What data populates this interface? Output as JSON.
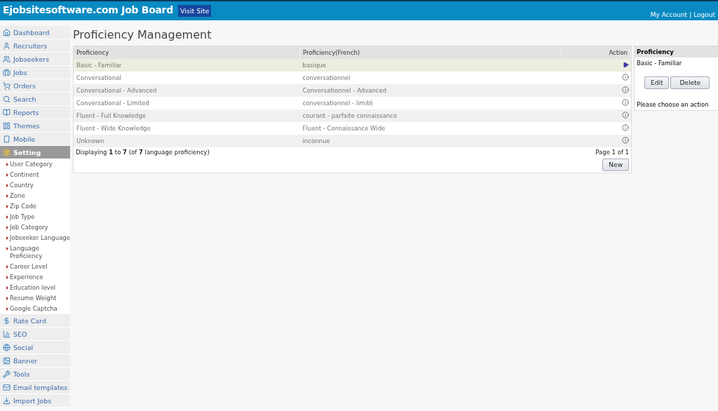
{
  "header": {
    "title": "Ejobsitesoftware.com Job Board",
    "visit_site": "Visit Site",
    "links": [
      "My Account",
      "Logout"
    ],
    "separator": "|"
  },
  "sidebar": {
    "items": [
      {
        "label": "Dashboard",
        "selected": false
      },
      {
        "label": "Recruiters",
        "selected": false
      },
      {
        "label": "Jobseekers",
        "selected": false
      },
      {
        "label": "Jobs",
        "selected": false
      },
      {
        "label": "Orders",
        "selected": false
      },
      {
        "label": "Search",
        "selected": false
      },
      {
        "label": "Reports",
        "selected": false
      },
      {
        "label": "Themes",
        "selected": false
      },
      {
        "label": "Mobile",
        "selected": false
      },
      {
        "label": "Setting",
        "selected": true,
        "children": [
          {
            "label": "User Category"
          },
          {
            "label": "Continent"
          },
          {
            "label": "Country"
          },
          {
            "label": "Zone"
          },
          {
            "label": "Zip Code"
          },
          {
            "label": "Job Type"
          },
          {
            "label": "Job Category"
          },
          {
            "label": "Jobseeker Language"
          },
          {
            "label": "Language Proficiency"
          },
          {
            "label": "Career Level"
          },
          {
            "label": "Experience"
          },
          {
            "label": "Education level"
          },
          {
            "label": "Resume Weight"
          },
          {
            "label": "Google Captcha"
          }
        ]
      },
      {
        "label": "Rate Card",
        "selected": false
      },
      {
        "label": "SEO",
        "selected": false
      },
      {
        "label": "Social",
        "selected": false
      },
      {
        "label": "Banner",
        "selected": false
      },
      {
        "label": "Tools",
        "selected": false
      },
      {
        "label": "Email templates",
        "selected": false
      },
      {
        "label": "Import Jobs",
        "selected": false
      }
    ]
  },
  "page_title": "Proficiency Management",
  "table": {
    "columns": [
      "Proficiency",
      "Proficiency(French)",
      "Action"
    ],
    "rows": [
      {
        "cells": [
          "Basic - Familiar",
          "basique"
        ],
        "selected": true
      },
      {
        "cells": [
          "Conversational",
          "conversationnel"
        ],
        "selected": false
      },
      {
        "cells": [
          "Conversational - Advanced",
          "Conversationnel - Advanced"
        ],
        "selected": false
      },
      {
        "cells": [
          "Conversational - Limited",
          "conversationnel - limité"
        ],
        "selected": false
      },
      {
        "cells": [
          "Fluent - Full Knowledge",
          "courant - parfaite connaissance"
        ],
        "selected": false
      },
      {
        "cells": [
          "Fluent - Wide Knowledge",
          "Fluent - Connaissance Wide"
        ],
        "selected": false
      },
      {
        "cells": [
          "Unknown",
          "inconnue"
        ],
        "selected": false
      }
    ],
    "summary": "Displaying **1** to **7** (of **7** language proficiency)",
    "pagination": "Page 1 of 1",
    "new_button": "New"
  },
  "detail_panel": {
    "title": "Proficiency",
    "value": "Basic - Familiar",
    "buttons": [
      "Edit",
      "Delete"
    ],
    "message": "Please choose an action"
  }
}
